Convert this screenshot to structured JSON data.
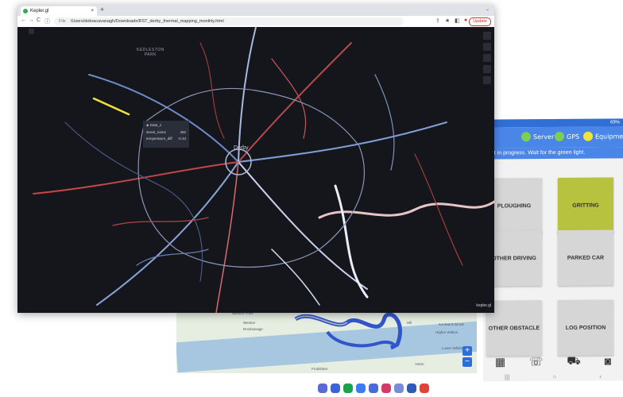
{
  "browser": {
    "tab_title": "Kepler.gl",
    "tab_close": "×",
    "new_tab": "+",
    "tab_menu": "⌄",
    "nav": {
      "back": "←",
      "forward": "→",
      "reload": "C",
      "info": "ⓘ"
    },
    "url_scheme": "File",
    "url": "/Users/debracavanagh/Downloads/RST_derby_thermal_mapping_monthly.html",
    "update_label": "Update",
    "map": {
      "park_label_1": "KEDLESTON",
      "park_label_2": "PARK",
      "city_label": "Derby",
      "tooltip": {
        "title": "Data_1",
        "rows": [
          {
            "key": "street_name",
            "value": "492"
          },
          {
            "key": "temperature_diff",
            "value": "-0.43"
          }
        ]
      },
      "attribution": "kepler.gl"
    }
  },
  "map_strip": {
    "labels": [
      "Weston Point",
      "Weston",
      "Rocksavage",
      "Frodsham",
      "Hill",
      "Keckwick Brook",
      "Higher Walton",
      "Lower Whitley",
      "Aston"
    ],
    "zoom_in": "+",
    "zoom_out": "−"
  },
  "tablet": {
    "status": "69%",
    "statuses": [
      {
        "label": "Server",
        "color": "#7ccf52"
      },
      {
        "label": "GPS",
        "color": "#7ccf52"
      },
      {
        "label": "Equipmen",
        "color": "#f0e43a"
      }
    ],
    "notice": "ent in progress. Wait for the green light.",
    "buttons": [
      "PLOUGHING",
      "GRITTING",
      "OTHER DRIVING",
      "PARKED CAR",
      "OTHER OBSTACLE",
      "LOG POSITION"
    ],
    "nav_icons": [
      "grid-icon",
      "phone-icon",
      "truck-icon",
      "camera-icon"
    ],
    "sys_nav": [
      "|||",
      "○",
      "‹"
    ]
  },
  "colors": {
    "accent": "#4a86e8",
    "gritting": "#b7c33e",
    "map_bg": "#14161c"
  }
}
